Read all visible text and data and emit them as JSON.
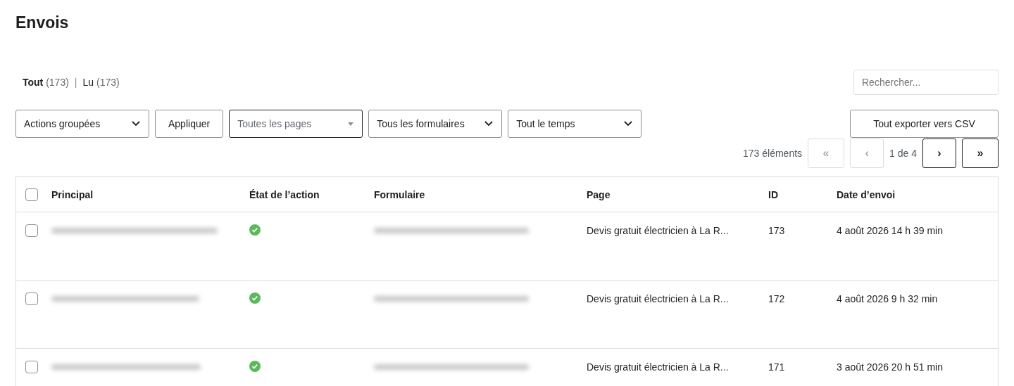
{
  "title": "Envois",
  "views": [
    {
      "label": "Tout",
      "count": "(173)",
      "selected": true
    },
    {
      "label": "Lu",
      "count": "(173)",
      "selected": false
    }
  ],
  "views_separator": "|",
  "search": {
    "placeholder": "Rechercher..."
  },
  "toolbar": {
    "bulk_actions": "Actions groupées",
    "apply": "Appliquer",
    "pages_filter": {
      "placeholder": "Toutes les pages"
    },
    "forms_filter": "Tous les formulaires",
    "date_filter": "Tout le temps",
    "export": "Tout exporter vers CSV"
  },
  "pagination": {
    "count": "173 éléments",
    "page": "1 de 4",
    "buttons": [
      {
        "label": "«",
        "disabled": true
      },
      {
        "label": "‹",
        "disabled": true
      },
      {
        "label": "›",
        "disabled": false
      },
      {
        "label": "»",
        "disabled": false
      }
    ]
  },
  "table": {
    "select_all_checked": false,
    "columns": [
      "Principal",
      "État de l’action",
      "Formulaire",
      "Page",
      "ID",
      "Date d’envoi"
    ],
    "rows": [
      {
        "checked": false,
        "action_ok": true,
        "page": "Devis gratuit électricien à La R...",
        "id": "173",
        "date": "4 août 2026 14 h 39 min"
      },
      {
        "checked": false,
        "action_ok": true,
        "page": "Devis gratuit électricien à La R...",
        "id": "172",
        "date": "4 août 2026 9 h 32 min"
      },
      {
        "checked": false,
        "action_ok": true,
        "page": "Devis gratuit électricien à La R...",
        "id": "171",
        "date": "3 août 2026 20 h 51 min"
      }
    ]
  }
}
